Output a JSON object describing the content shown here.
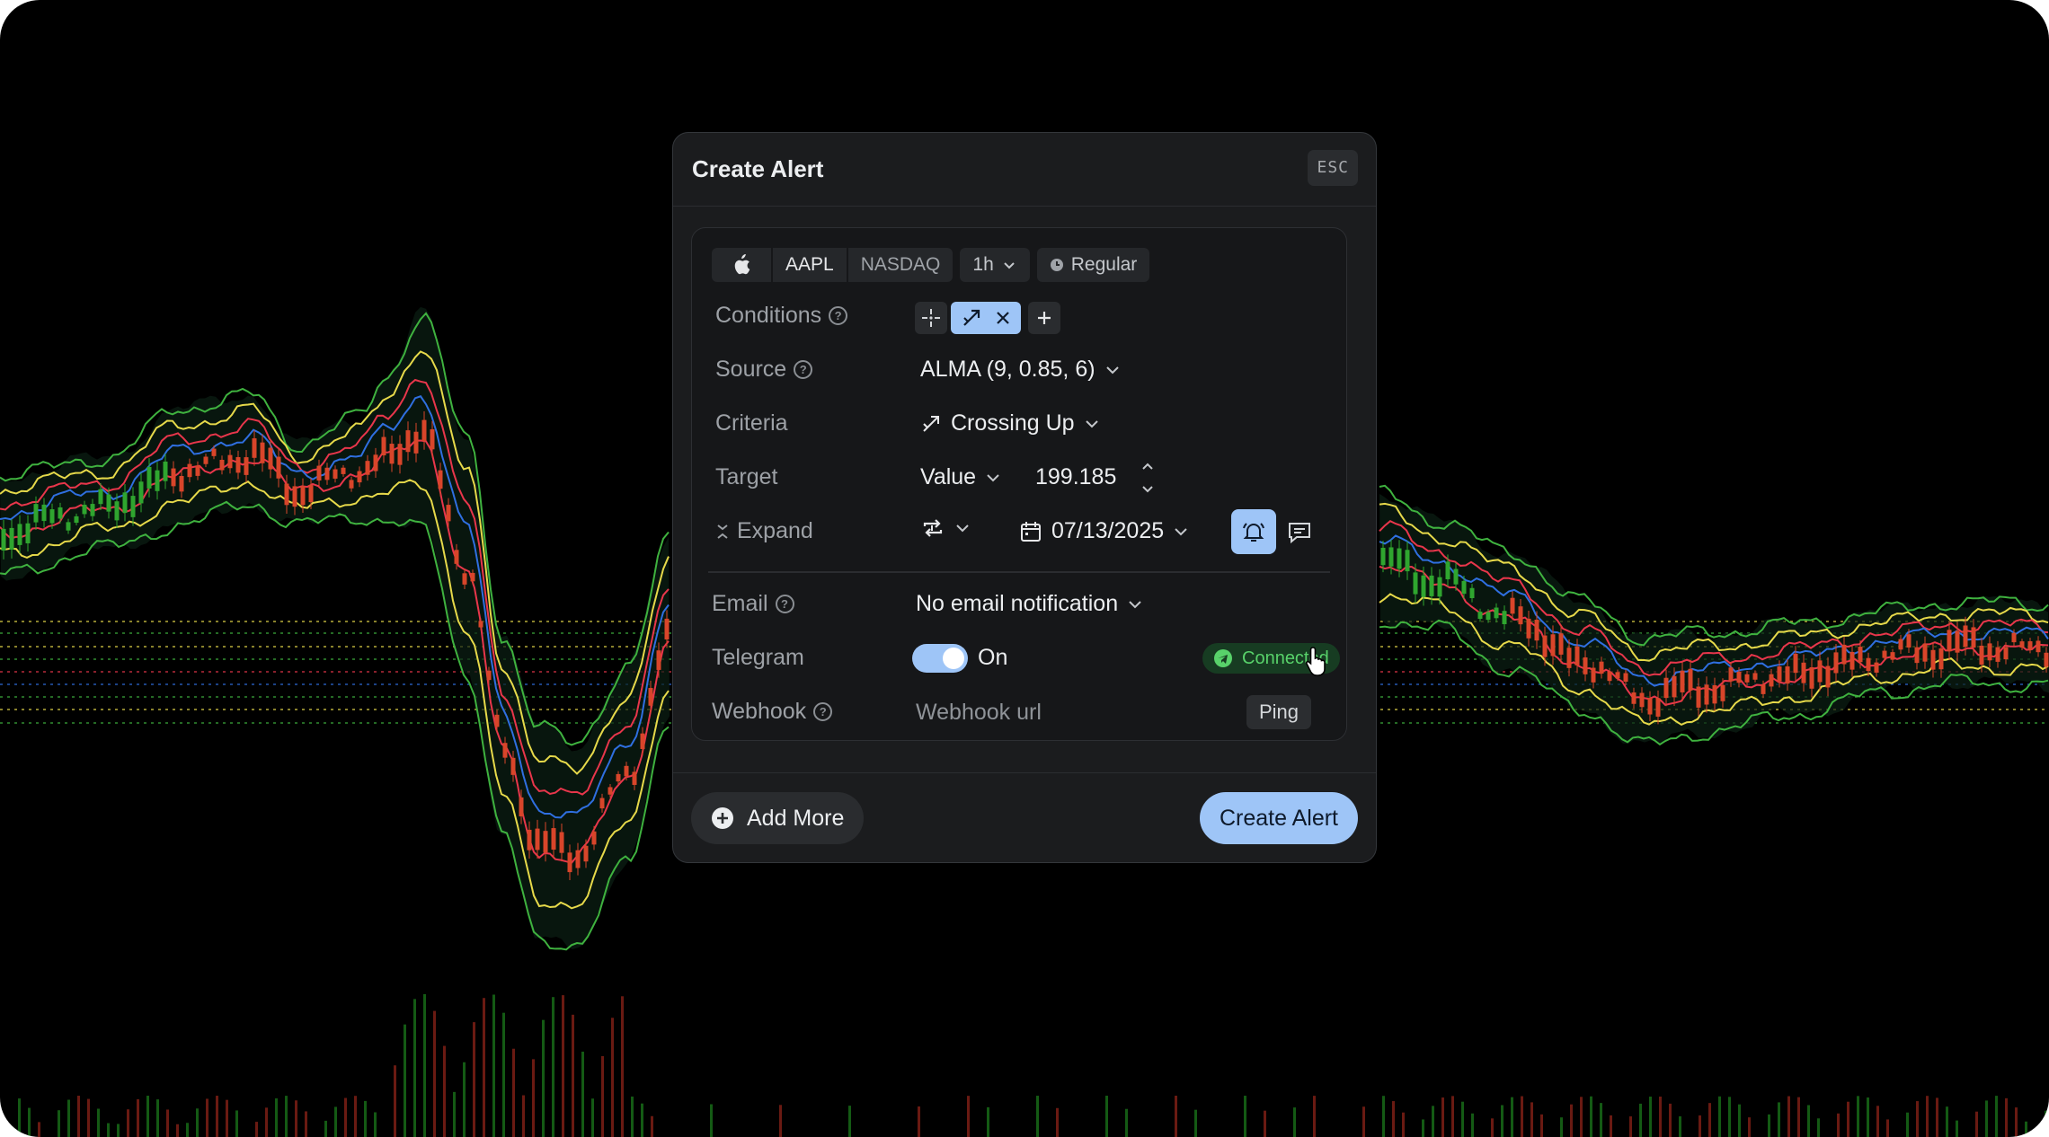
{
  "dialog": {
    "title": "Create Alert",
    "esc_label": "ESC"
  },
  "symbol_bar": {
    "icon": "apple-logo-icon",
    "ticker": "AAPL",
    "exchange": "NASDAQ",
    "interval": "1h",
    "session": "Regular"
  },
  "rows": {
    "conditions": {
      "label": "Conditions"
    },
    "source": {
      "label": "Source",
      "value": "ALMA (9, 0.85, 6)"
    },
    "criteria": {
      "label": "Criteria",
      "value": "Crossing Up"
    },
    "target": {
      "label": "Target",
      "type": "Value",
      "value": "199.185"
    },
    "expand": {
      "label": "Expand",
      "date": "07/13/2025"
    },
    "email": {
      "label": "Email",
      "value": "No email notification"
    },
    "telegram": {
      "label": "Telegram",
      "toggle_label": "On",
      "status": "Connected"
    },
    "webhook": {
      "label": "Webhook",
      "placeholder": "Webhook url",
      "ping_label": "Ping"
    }
  },
  "footer": {
    "add_more_label": "Add More",
    "create_label": "Create Alert"
  },
  "colors": {
    "accent": "#9ec5f7",
    "connected": "#58d26a",
    "dialog_bg": "#1b1c1e",
    "band_outer": "#3fb23f",
    "band_mid": "#e6d94a",
    "band_red": "#e8364b",
    "band_blue": "#2f6fe0"
  }
}
